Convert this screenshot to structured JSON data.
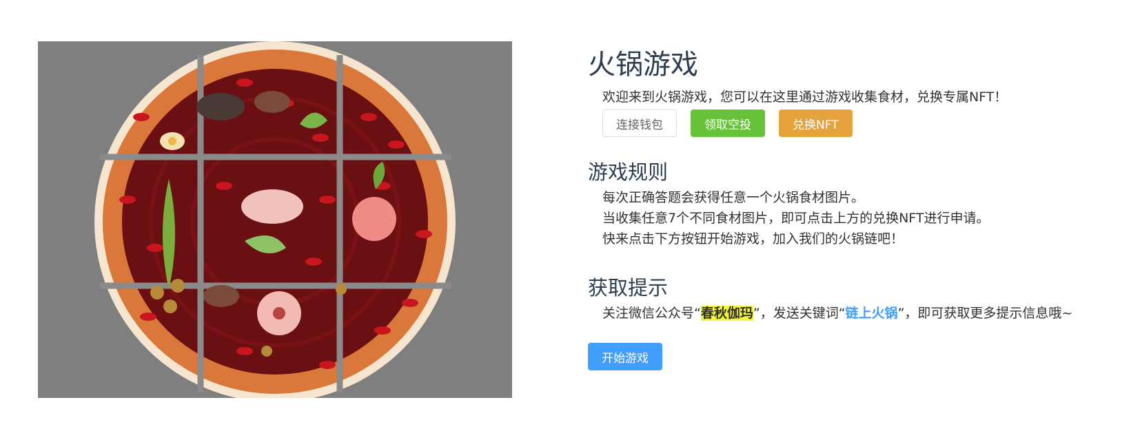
{
  "hero": {
    "alt_icon": "hotpot-illustration"
  },
  "header": {
    "title": "火锅游戏",
    "welcome": "欢迎来到火锅游戏，您可以在这里通过游戏收集食材，兑换专属NFT！"
  },
  "actions": {
    "connect_wallet": "连接钱包",
    "claim_airdrop": "领取空投",
    "exchange_nft": "兑换NFT"
  },
  "rules": {
    "heading": "游戏规则",
    "lines": [
      "每次正确答题会获得任意一个火锅食材图片。",
      "当收集任意7个不同食材图片，即可点击上方的兑换NFT进行申请。",
      "快来点击下方按钮开始游戏，加入我们的火锅链吧！"
    ]
  },
  "tips": {
    "heading": "获取提示",
    "prefix": "关注微信公众号“",
    "account": "春秋伽玛",
    "middle": "”，发送关键词“",
    "keyword": "链上火锅",
    "suffix": "”，即可获取更多提示信息哦~"
  },
  "start": {
    "label": "开始游戏"
  },
  "colors": {
    "primary": "#409eff",
    "success": "#67c23a",
    "warning": "#e6a23c",
    "title": "#2c3e50",
    "highlight": "#f5f536"
  }
}
